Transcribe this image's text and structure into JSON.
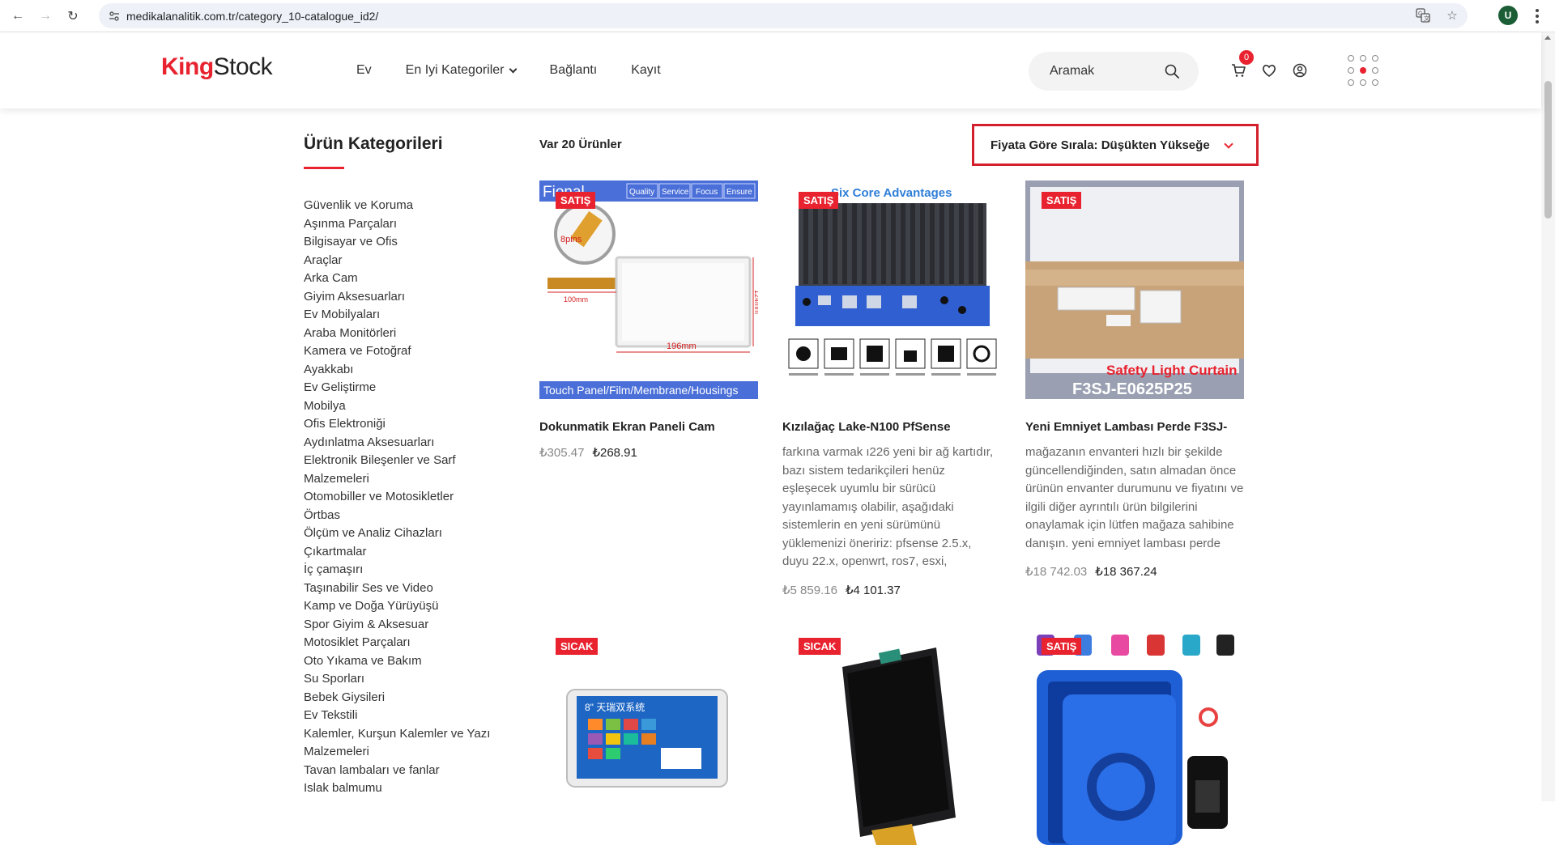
{
  "browser": {
    "url": "medikalanalitik.com.tr/category_10-catalogue_id2/",
    "profile_initial": "U"
  },
  "header": {
    "logo_part1": "King",
    "logo_part2": "Stock",
    "nav": [
      {
        "label": "Ev"
      },
      {
        "label": "En Iyi Kategoriler"
      },
      {
        "label": "Bağlantı"
      },
      {
        "label": "Kayıt"
      }
    ],
    "search_placeholder": "Aramak",
    "cart_count": "0"
  },
  "sidebar": {
    "title": "Ürün Kategorileri",
    "categories": [
      "Güvenlik ve Koruma",
      "Aşınma Parçaları",
      "Bilgisayar ve Ofis",
      "Araçlar",
      "Arka Cam",
      "Giyim Aksesuarları",
      "Ev Mobilyaları",
      "Araba Monitörleri",
      "Kamera ve Fotoğraf",
      "Ayakkabı",
      "Ev Geliştirme",
      "Mobilya",
      "Ofis Elektroniği",
      "Aydınlatma Aksesuarları",
      "Elektronik Bileşenler ve Sarf",
      "Malzemeleri",
      "Otomobiller ve Motosikletler",
      "Örtbas",
      "Ölçüm ve Analiz Cihazları",
      "Çıkartmalar",
      "İç çamaşırı",
      "Taşınabilir Ses ve Video",
      "Kamp ve Doğa Yürüyüşü",
      "Spor Giyim & Aksesuar",
      "Motosiklet Parçaları",
      "Oto Yıkama ve Bakım",
      "Su Sporları",
      "Bebek Giysileri",
      "Ev Tekstili",
      "Kalemler, Kurşun Kalemler ve Yazı",
      "Malzemeleri",
      "Tavan lambaları ve fanlar",
      "Islak balmumu"
    ]
  },
  "toolbar": {
    "count": "Var 20 Ürünler",
    "sort": "Fiyata Göre Sırala: Düşükten Yükseğe"
  },
  "products": [
    {
      "badge": "SATIŞ",
      "name": "Dokunmatik Ekran Paneli Cam",
      "desc": "",
      "old_price": "₺305.47",
      "new_price": "₺268.91",
      "image_text": {
        "brand": "Fional",
        "tags": [
          "Quality",
          "Service",
          "Focus",
          "Ensure"
        ],
        "pins": "8pins",
        "dim_w": "196mm",
        "dim_h": "124mm",
        "dim_cable": "100mm",
        "footer": "Touch Panel/Film/Membrane/Housings"
      }
    },
    {
      "badge": "SATIŞ",
      "name": "Kızılağaç Lake-N100 PfSense",
      "desc": "farkına varmak ı226 yeni bir ağ kartıdır, bazı sistem tedarikçileri henüz eşleşecek uyumlu bir sürücü yayınlamamış olabilir, aşağıdaki sistemlerin en yeni sürümünü yüklemenizi öneririz: pfsense 2.5.x, duyu 22.x, openwrt, ros7, esxi,",
      "old_price": "₺5 859.16",
      "new_price": "₺4 101.37",
      "image_text": {
        "headline": "Six Core Advantages"
      }
    },
    {
      "badge": "SATIŞ",
      "name": "Yeni Emniyet Lambası Perde F3SJ-",
      "desc": "mağazanın envanteri hızlı bir şekilde güncellendiğinden, satın almadan önce ürünün envanter durumunu ve fiyatını ve ilgili diğer ayrıntılı ürün bilgilerini onaylamak için lütfen mağaza sahibine danışın. yeni emniyet lambası perde",
      "old_price": "₺18 742.03",
      "new_price": "₺18 367.24",
      "image_text": {
        "caption": "Safety Light Curtain",
        "model": "F3SJ-E0625P25"
      }
    },
    {
      "badge": "SICAK",
      "name": "",
      "desc": "",
      "old_price": "",
      "new_price": "",
      "image_text": {
        "label": "8\" 天瑞双系统"
      }
    },
    {
      "badge": "SICAK",
      "name": "",
      "desc": "",
      "old_price": "",
      "new_price": ""
    },
    {
      "badge": "SATIŞ",
      "name": "",
      "desc": "",
      "old_price": "",
      "new_price": ""
    }
  ],
  "colors": {
    "accent": "#e8232f",
    "highlight_border": "#d4202c"
  }
}
